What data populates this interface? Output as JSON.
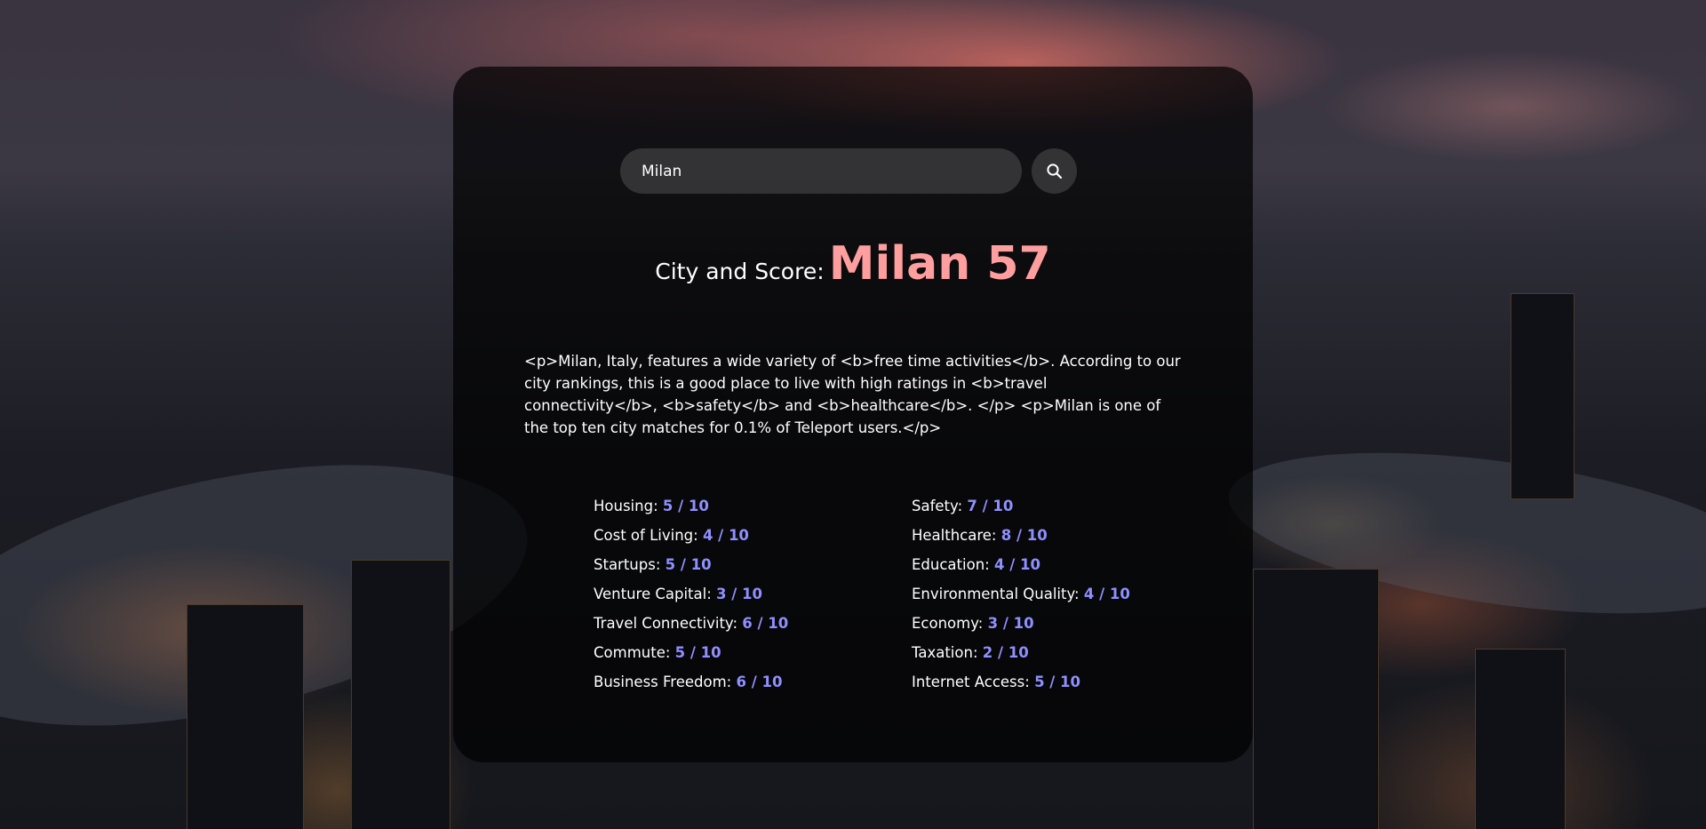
{
  "search": {
    "value": "Milan",
    "button_icon": "search-icon"
  },
  "heading": {
    "label": "City and Score:",
    "value": "Milan 57"
  },
  "summary": "<p>Milan, Italy, features a wide variety of <b>free time activities</b>. According to our city rankings, this is a good place to live with high ratings in <b>travel connectivity</b>, <b>safety</b> and <b>healthcare</b>. </p> <p>Milan is one of the top ten city matches for 0.1% of Teleport users.</p>",
  "scores": {
    "left": [
      {
        "label": "Housing:",
        "value": "5 / 10"
      },
      {
        "label": "Cost of Living:",
        "value": "4 / 10"
      },
      {
        "label": "Startups:",
        "value": "5 / 10"
      },
      {
        "label": "Venture Capital:",
        "value": "3 / 10"
      },
      {
        "label": "Travel Connectivity:",
        "value": "6 / 10"
      },
      {
        "label": "Commute:",
        "value": "5 / 10"
      },
      {
        "label": "Business Freedom:",
        "value": "6 / 10"
      }
    ],
    "right": [
      {
        "label": "Safety:",
        "value": "7 / 10"
      },
      {
        "label": "Healthcare:",
        "value": "8 / 10"
      },
      {
        "label": "Education:",
        "value": "4 / 10"
      },
      {
        "label": "Environmental Quality:",
        "value": "4 / 10"
      },
      {
        "label": "Economy:",
        "value": "3 / 10"
      },
      {
        "label": "Taxation:",
        "value": "2 / 10"
      },
      {
        "label": "Internet Access:",
        "value": "5 / 10"
      }
    ]
  },
  "colors": {
    "score_accent": "#ff9e9e",
    "rating_accent": "#8f8fff",
    "panel": "#000000"
  }
}
